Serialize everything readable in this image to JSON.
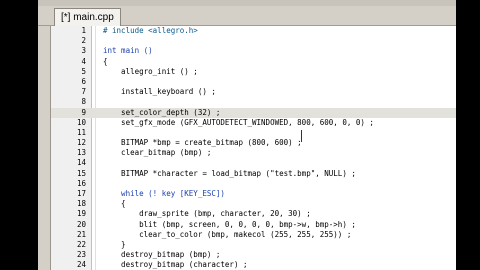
{
  "tab": {
    "label": "[*] main.cpp"
  },
  "editor": {
    "current_line": 9,
    "lines": [
      {
        "n": "1",
        "text": "# include <allegro.h>",
        "kind": "pp"
      },
      {
        "n": "2",
        "text": "",
        "kind": ""
      },
      {
        "n": "3",
        "text": "int main ()",
        "kind": "kw"
      },
      {
        "n": "4",
        "text": "{",
        "kind": ""
      },
      {
        "n": "5",
        "text": "    allegro_init () ;",
        "kind": ""
      },
      {
        "n": "6",
        "text": "",
        "kind": ""
      },
      {
        "n": "7",
        "text": "    install_keyboard () ;",
        "kind": ""
      },
      {
        "n": "8",
        "text": "",
        "kind": ""
      },
      {
        "n": "9",
        "text": "    set_color_depth (32) ;",
        "kind": ""
      },
      {
        "n": "10",
        "text": "    set_gfx_mode (GFX_AUTODETECT_WINDOWED, 800, 600, 0, 0) ;",
        "kind": ""
      },
      {
        "n": "11",
        "text": "",
        "kind": ""
      },
      {
        "n": "12",
        "text": "    BITMAP *bmp = create_bitmap (800, 600) ;",
        "kind": ""
      },
      {
        "n": "13",
        "text": "    clear_bitmap (bmp) ;",
        "kind": ""
      },
      {
        "n": "14",
        "text": "",
        "kind": ""
      },
      {
        "n": "15",
        "text": "    BITMAP *character = load_bitmap (\"test.bmp\", NULL) ;",
        "kind": ""
      },
      {
        "n": "16",
        "text": "",
        "kind": ""
      },
      {
        "n": "17",
        "text": "    while (! key [KEY_ESC])",
        "kind": "kw"
      },
      {
        "n": "18",
        "text": "    {",
        "kind": ""
      },
      {
        "n": "19",
        "text": "        draw_sprite (bmp, character, 20, 30) ;",
        "kind": ""
      },
      {
        "n": "20",
        "text": "        blit (bmp, screen, 0, 0, 0, 0, bmp->w, bmp->h) ;",
        "kind": ""
      },
      {
        "n": "21",
        "text": "        clear_to_color (bmp, makecol (255, 255, 255)) ;",
        "kind": ""
      },
      {
        "n": "22",
        "text": "    }",
        "kind": ""
      },
      {
        "n": "23",
        "text": "    destroy_bitmap (bmp) ;",
        "kind": ""
      },
      {
        "n": "24",
        "text": "    destroy_bitmap (character) ;",
        "kind": ""
      }
    ]
  }
}
